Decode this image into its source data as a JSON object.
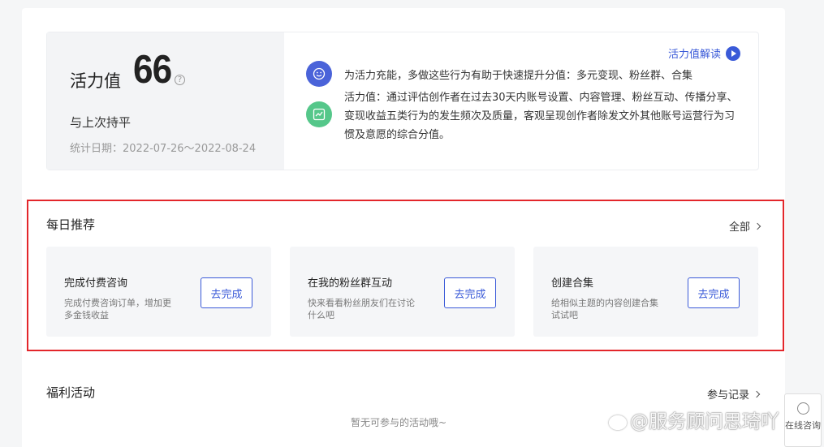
{
  "vitality": {
    "label": "活力值",
    "score": "66",
    "help_icon": "?",
    "trend": "与上次持平",
    "date_range": "统计日期：2022-07-26～2022-08-24",
    "explain_link": "活力值解读",
    "tip_boost": "为活力充能，多做这些行为有助于快速提升分值：多元变现、粉丝群、合集",
    "tip_definition": "活力值：通过评估创作者在过去30天内账号设置、内容管理、粉丝互动、传播分享、变现收益五类行为的发生频次及质量，客观呈现创作者除发文外其他账号运营行为习惯及意愿的综合分值。",
    "colors": {
      "accent": "#3a5ad8",
      "smile_icon_bg": "#4a63d9",
      "chart_icon_bg": "#55c78a"
    }
  },
  "daily": {
    "title": "每日推荐",
    "all_link": "全部",
    "highlight_color": "#e3262b",
    "tasks": [
      {
        "title": "完成付费咨询",
        "desc": "完成付费咨询订单，增加更多金钱收益",
        "button": "去完成"
      },
      {
        "title": "在我的粉丝群互动",
        "desc": "快来看看粉丝朋友们在讨论什么吧",
        "button": "去完成"
      },
      {
        "title": "创建合集",
        "desc": "给相似主题的内容创建合集试试吧",
        "button": "去完成"
      }
    ]
  },
  "welfare": {
    "title": "福利活动",
    "records_link": "参与记录",
    "empty_text": "暂无可参与的活动哦~"
  },
  "watermark": "@服务顾问思琦吖",
  "consult": {
    "label": "在线咨询"
  }
}
